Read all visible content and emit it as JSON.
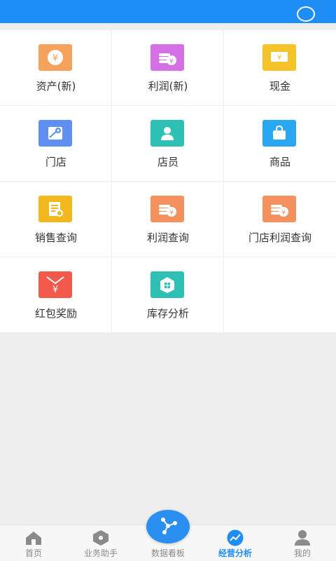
{
  "colors": {
    "header_bg": "#1e8ef6",
    "tab_active": "#1e8ef6",
    "tab_inactive": "#8a8a8a"
  },
  "grid": {
    "items": [
      {
        "label": "资产(新)",
        "icon": "money-coin-icon",
        "color": "#f5a35c"
      },
      {
        "label": "利润(新)",
        "icon": "coin-stack-icon",
        "color": "#d56fe6"
      },
      {
        "label": "现金",
        "icon": "banknote-icon",
        "color": "#f5c22a"
      },
      {
        "label": "门店",
        "icon": "map-pin-icon",
        "color": "#5f8ff0"
      },
      {
        "label": "店员",
        "icon": "person-icon",
        "color": "#2fc0b5"
      },
      {
        "label": "商品",
        "icon": "shopping-bag-icon",
        "color": "#2aa7f1"
      },
      {
        "label": "销售查询",
        "icon": "document-search-icon",
        "color": "#f3b81d"
      },
      {
        "label": "利润查询",
        "icon": "coin-stack-icon",
        "color": "#f5905f"
      },
      {
        "label": "门店利润查询",
        "icon": "coin-stack-icon",
        "color": "#f5905f"
      },
      {
        "label": "红包奖励",
        "icon": "red-envelope-icon",
        "color": "#f2594b"
      },
      {
        "label": "库存分析",
        "icon": "warehouse-icon",
        "color": "#2fc0b5"
      }
    ]
  },
  "tabbar": {
    "tabs": [
      {
        "label": "首页",
        "icon": "home-icon",
        "active": false
      },
      {
        "label": "业务助手",
        "icon": "tag-icon",
        "active": false
      },
      {
        "label": "数据看板",
        "icon": "share-network-icon",
        "active": false
      },
      {
        "label": "经营分析",
        "icon": "chart-line-icon",
        "active": true
      },
      {
        "label": "我的",
        "icon": "user-icon",
        "active": false
      }
    ]
  }
}
